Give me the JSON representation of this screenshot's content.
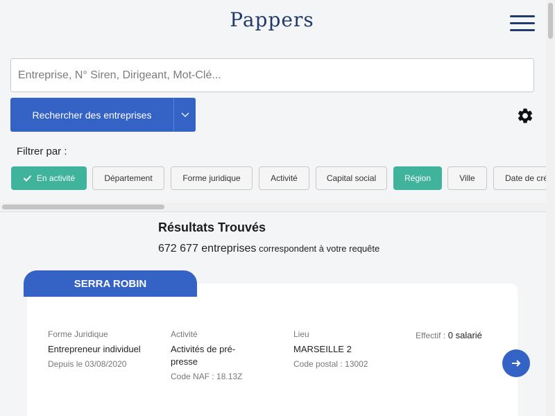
{
  "header": {
    "logo": "Pappers"
  },
  "search": {
    "placeholder": "Entreprise, N° Siren, Dirigeant, Mot-Clé...",
    "button_label": "Rechercher des entreprises"
  },
  "filters": {
    "label": "Filtrer par :",
    "chips": [
      {
        "label": "En activité",
        "active": true
      },
      {
        "label": "Département",
        "active": false
      },
      {
        "label": "Forme juridique",
        "active": false
      },
      {
        "label": "Activité",
        "active": false
      },
      {
        "label": "Capital social",
        "active": false
      },
      {
        "label": "Région",
        "active": true
      },
      {
        "label": "Ville",
        "active": false
      },
      {
        "label": "Date de création",
        "active": false
      }
    ]
  },
  "results": {
    "title": "Résultats Trouvés",
    "count": "672 677 entreprises",
    "count_suffix": "correspondent à votre requête"
  },
  "company": {
    "name": "SERRA ROBIN",
    "forme": {
      "label": "Forme Juridique",
      "value": "Entrepreneur individuel",
      "sub": "Depuis le 03/08/2020"
    },
    "activite": {
      "label": "Activité",
      "value": "Activités de pré-presse",
      "sub": "Code NAF : 18.13Z"
    },
    "lieu": {
      "label": "Lieu",
      "value": "MARSEILLE 2",
      "sub": "Code postal : 13002"
    },
    "effectif": {
      "label": "Effectif :",
      "value": "0 salarié"
    }
  },
  "colors": {
    "primary": "#3562c5",
    "accent": "#3fb39b",
    "brand": "#213a6b"
  },
  "icons": [
    "hamburger-menu-icon",
    "chevron-down-icon",
    "gear-icon",
    "check-icon",
    "arrow-right-icon"
  ]
}
